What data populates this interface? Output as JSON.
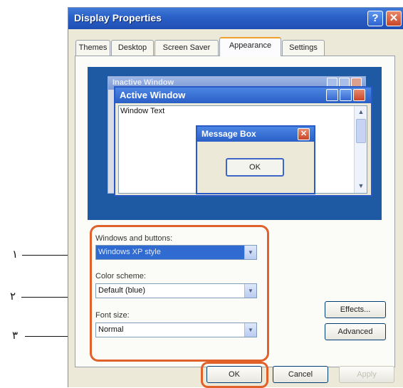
{
  "window": {
    "title": "Display Properties",
    "help_label": "?",
    "close_label": "✕"
  },
  "tabs": [
    "Themes",
    "Desktop",
    "Screen Saver",
    "Appearance",
    "Settings"
  ],
  "preview": {
    "inactive_title": "Inactive Window",
    "active_title": "Active Window",
    "window_text": "Window Text",
    "message_title": "Message Box",
    "message_ok": "OK"
  },
  "appearance": {
    "windows_buttons_label": "Windows and buttons:",
    "windows_buttons_value": "Windows XP style",
    "color_scheme_label": "Color scheme:",
    "color_scheme_value": "Default (blue)",
    "font_size_label": "Font size:",
    "font_size_value": "Normal",
    "effects_label": "Effects...",
    "advanced_label": "Advanced"
  },
  "dialog_buttons": {
    "ok": "OK",
    "cancel": "Cancel",
    "apply": "Apply"
  },
  "callouts": [
    "١",
    "٢",
    "٣"
  ],
  "colors": {
    "highlight": "#e0612a",
    "title_bar": "#2a5fc6",
    "preview_bg": "#1d5aa3"
  }
}
